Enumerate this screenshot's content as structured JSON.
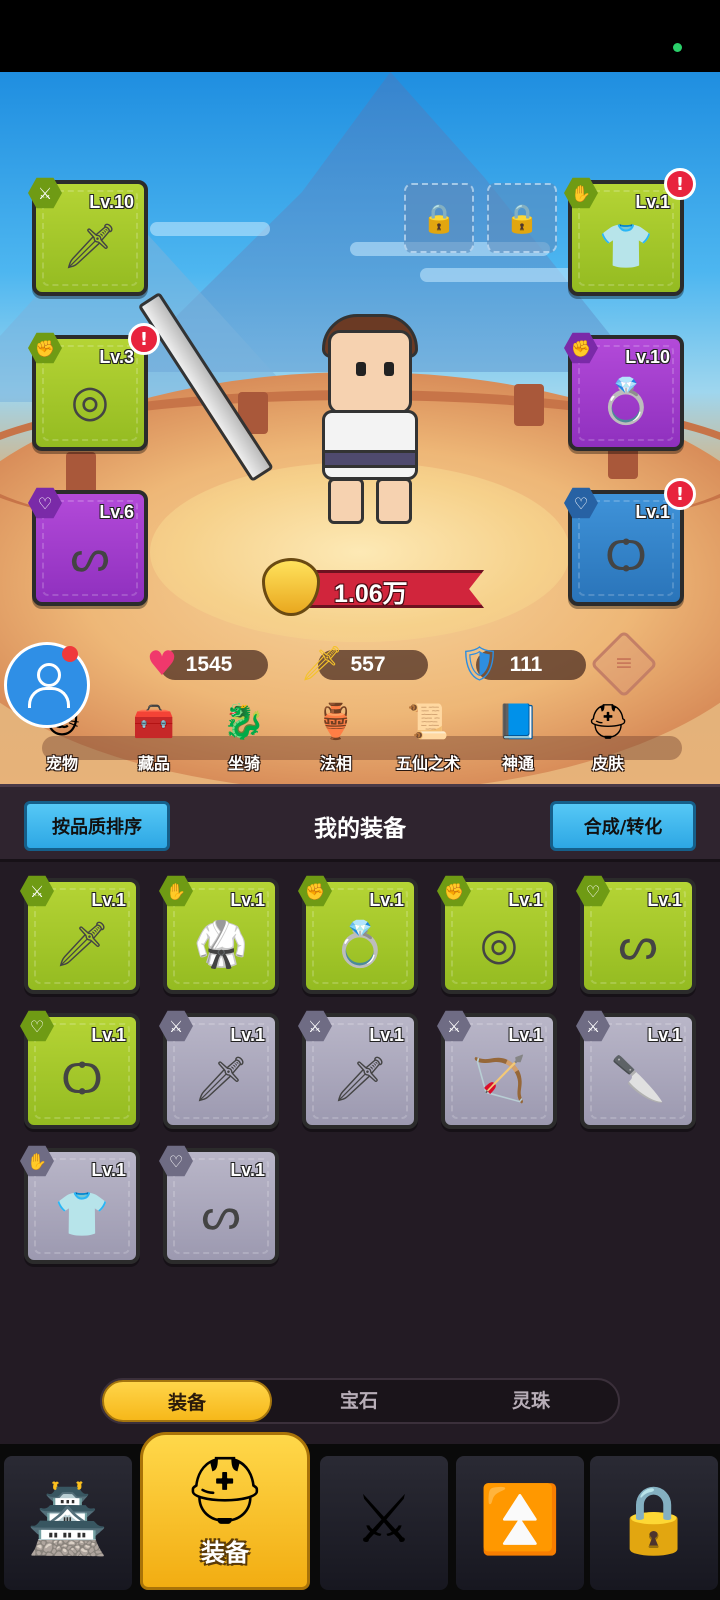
{
  "hero": {
    "power": "1.06万",
    "slots_left": [
      {
        "level": "Lv.10",
        "rarity": "green",
        "icon": "sword-icon",
        "glyph": "🗡",
        "alert": false,
        "badge": "⚔"
      },
      {
        "level": "Lv.3",
        "rarity": "green",
        "icon": "ring-icon",
        "glyph": "◎",
        "alert": true,
        "badge": "✊"
      },
      {
        "level": "Lv.6",
        "rarity": "purple",
        "icon": "necklace-icon",
        "glyph": "ᔕ",
        "alert": false,
        "badge": "♡"
      }
    ],
    "slots_right": [
      {
        "level": "Lv.1",
        "rarity": "green",
        "icon": "shirt-icon",
        "glyph": "👕",
        "alert": true,
        "badge": "✋"
      },
      {
        "level": "Lv.10",
        "rarity": "purple",
        "icon": "gem-ring-icon",
        "glyph": "💍",
        "alert": false,
        "badge": "✊"
      },
      {
        "level": "Lv.1",
        "rarity": "blue",
        "icon": "cord-necklace-icon",
        "glyph": "Ѻ",
        "alert": true,
        "badge": "♡"
      }
    ],
    "alert_mark": "!"
  },
  "stats": {
    "hp": "1545",
    "attack": "557",
    "defense": "111"
  },
  "features": [
    {
      "label": "宠物",
      "icon": "pet-icon",
      "glyph": "🐱"
    },
    {
      "label": "藏品",
      "icon": "chest-icon",
      "glyph": "🧰"
    },
    {
      "label": "坐骑",
      "icon": "mount-icon",
      "glyph": "🐉"
    },
    {
      "label": "法相",
      "icon": "teapot-icon",
      "glyph": "🏺"
    },
    {
      "label": "五仙之术",
      "icon": "scroll-icon",
      "glyph": "📜"
    },
    {
      "label": "神通",
      "icon": "book-icon",
      "glyph": "📘"
    },
    {
      "label": "皮肤",
      "icon": "helmet-icon",
      "glyph": "⛑"
    }
  ],
  "inventory": {
    "sort_label": "按品质排序",
    "title": "我的装备",
    "merge_label": "合成/转化",
    "items": [
      {
        "level": "Lv.1",
        "rarity": "green",
        "icon": "sword-icon",
        "glyph": "🗡",
        "badge": "⚔"
      },
      {
        "level": "Lv.1",
        "rarity": "green",
        "icon": "robe-icon",
        "glyph": "🥋",
        "badge": "✋"
      },
      {
        "level": "Lv.1",
        "rarity": "green",
        "icon": "gem-ring-icon",
        "glyph": "💍",
        "badge": "✊"
      },
      {
        "level": "Lv.1",
        "rarity": "green",
        "icon": "ring-icon",
        "glyph": "◎",
        "badge": "✊"
      },
      {
        "level": "Lv.1",
        "rarity": "green",
        "icon": "necklace-icon",
        "glyph": "ᔕ",
        "badge": "♡"
      },
      {
        "level": "Lv.1",
        "rarity": "green",
        "icon": "cord-necklace-icon",
        "glyph": "Ѻ",
        "badge": "♡"
      },
      {
        "level": "Lv.1",
        "rarity": "grey",
        "icon": "sword-icon",
        "glyph": "🗡",
        "badge": "⚔"
      },
      {
        "level": "Lv.1",
        "rarity": "grey",
        "icon": "sword-icon",
        "glyph": "🗡",
        "badge": "⚔"
      },
      {
        "level": "Lv.1",
        "rarity": "grey",
        "icon": "bow-icon",
        "glyph": "🏹",
        "badge": "⚔"
      },
      {
        "level": "Lv.1",
        "rarity": "grey",
        "icon": "cleaver-icon",
        "glyph": "🔪",
        "badge": "⚔"
      },
      {
        "level": "Lv.1",
        "rarity": "grey",
        "icon": "shirt-icon",
        "glyph": "👕",
        "badge": "✋"
      },
      {
        "level": "Lv.1",
        "rarity": "grey",
        "icon": "necklace-icon",
        "glyph": "ᔕ",
        "badge": "♡"
      }
    ]
  },
  "tabs": [
    {
      "label": "装备",
      "active": true
    },
    {
      "label": "宝石",
      "active": false
    },
    {
      "label": "灵珠",
      "active": false
    }
  ],
  "nav": {
    "active_label": "装备"
  },
  "colors": {
    "green": "#a6c92b",
    "purple": "#a03fcc",
    "blue": "#3584cb",
    "grey": "#aaa7bd",
    "accent_yellow": "#f6b81a",
    "alert_red": "#e8233d"
  }
}
